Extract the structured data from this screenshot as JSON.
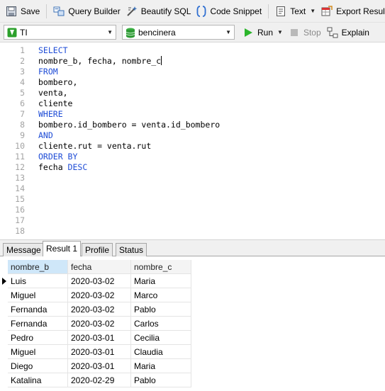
{
  "toolbar": {
    "save": "Save",
    "query_builder": "Query Builder",
    "beautify_sql": "Beautify SQL",
    "code_snippet": "Code Snippet",
    "text": "Text",
    "export_result": "Export Result"
  },
  "connection": {
    "selected": "TI"
  },
  "database": {
    "selected": "bencinera"
  },
  "actions": {
    "run": "Run",
    "stop": "Stop",
    "explain": "Explain"
  },
  "editor": {
    "line_numbers": [
      "1",
      "2",
      "3",
      "4",
      "5",
      "6",
      "7",
      "8",
      "9",
      "10",
      "11",
      "12",
      "13",
      "14",
      "15",
      "16",
      "17",
      "18"
    ],
    "lines": [
      {
        "kw": "SELECT",
        "rest": ""
      },
      {
        "kw": "",
        "rest": "nombre_b, fecha, nombre_c"
      },
      {
        "kw": "FROM",
        "rest": ""
      },
      {
        "kw": "",
        "rest": "bombero,"
      },
      {
        "kw": "",
        "rest": "venta,"
      },
      {
        "kw": "",
        "rest": "cliente"
      },
      {
        "kw": "WHERE",
        "rest": ""
      },
      {
        "kw": "",
        "rest": "bombero.id_bombero = venta.id_bombero"
      },
      {
        "kw": "AND",
        "rest": ""
      },
      {
        "kw": "",
        "rest": "cliente.rut = venta.rut"
      },
      {
        "kw": "ORDER BY",
        "rest": ""
      },
      {
        "kw": "",
        "rest": "fecha ",
        "kw2": "DESC"
      }
    ]
  },
  "result_tabs": [
    "Message",
    "Result 1",
    "Profile",
    "Status"
  ],
  "active_tab": "Result 1",
  "result": {
    "columns": [
      "nombre_b",
      "fecha",
      "nombre_c"
    ],
    "rows": [
      [
        "Luis",
        "2020-03-02",
        "Maria"
      ],
      [
        "Miguel",
        "2020-03-02",
        "Marco"
      ],
      [
        "Fernanda",
        "2020-03-02",
        "Pablo"
      ],
      [
        "Fernanda",
        "2020-03-02",
        "Carlos"
      ],
      [
        "Pedro",
        "2020-03-01",
        "Cecilia"
      ],
      [
        "Miguel",
        "2020-03-01",
        "Claudia"
      ],
      [
        "Diego",
        "2020-03-01",
        "Maria"
      ],
      [
        "Katalina",
        "2020-02-29",
        "Pablo"
      ]
    ]
  },
  "colors": {
    "keyword": "#1e4cd6",
    "line_number": "#a3a3a3",
    "selected_header": "#cfe7f9",
    "run_green": "#2bb52b"
  }
}
